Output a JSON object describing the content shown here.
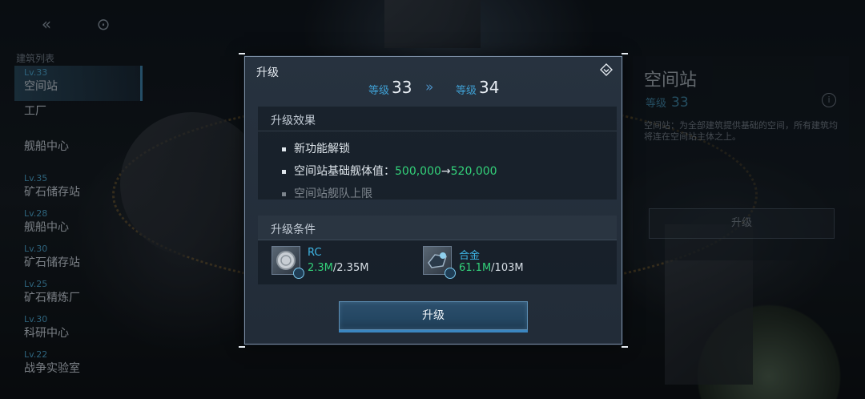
{
  "left_panel": {
    "list_title": "建筑列表",
    "items": [
      {
        "level": "Lv.33",
        "name": "空间站",
        "active": true
      },
      {
        "level": "",
        "name": "工厂"
      },
      {
        "level": "",
        "name": "舰船中心"
      },
      {
        "level": "Lv.35",
        "name": "矿石储存站"
      },
      {
        "level": "Lv.28",
        "name": "舰船中心"
      },
      {
        "level": "Lv.30",
        "name": "矿石储存站"
      },
      {
        "level": "Lv.25",
        "name": "矿石精炼厂"
      },
      {
        "level": "Lv.30",
        "name": "科研中心"
      },
      {
        "level": "Lv.22",
        "name": "战争实验室"
      }
    ]
  },
  "right_panel": {
    "title": "空间站",
    "level_label": "等级",
    "level_value": "33",
    "info_icon": "info-icon",
    "description": "空间站：为全部建筑提供基础的空间，所有建筑均将连在空间站主体之上。",
    "button_label": "升级"
  },
  "modal": {
    "title": "升级",
    "close_icon": "close-diamond-icon",
    "level_from_label": "等级",
    "level_from": "33",
    "level_to_label": "等级",
    "level_to": "34",
    "effects_title": "升级效果",
    "effects": [
      {
        "text": "新功能解锁"
      },
      {
        "text": "空间站基础舰体值：",
        "from": "500,000",
        "arrow": "→",
        "to": "520,000"
      },
      {
        "text": "空间站舰队上限"
      }
    ],
    "conditions_title": "升级条件",
    "resources": [
      {
        "name": "RC",
        "have": "2.3M",
        "need": "/2.35M",
        "icon": "rc-coin-icon"
      },
      {
        "name": "合金",
        "have": "61.1M",
        "need": "/103M",
        "icon": "alloy-icon"
      }
    ],
    "upgrade_button": "升级"
  },
  "colors": {
    "accent_blue": "#3f9fd2",
    "green": "#33d27a",
    "panel_bg": "#27323f"
  }
}
